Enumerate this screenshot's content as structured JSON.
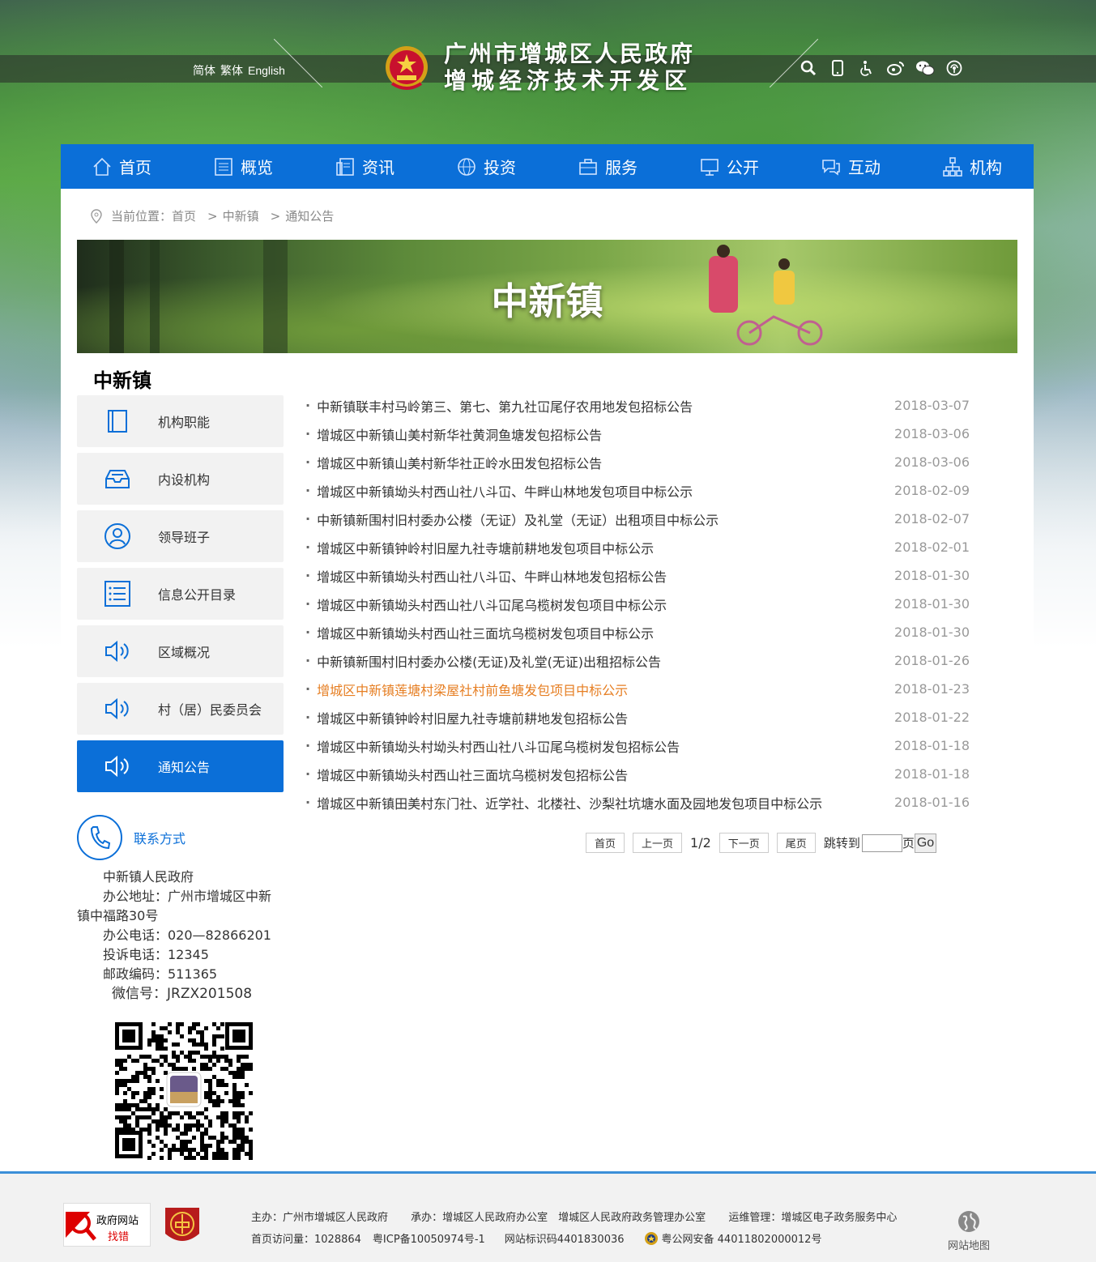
{
  "lang": [
    "简体",
    "繁体",
    "English"
  ],
  "site_title": {
    "line1": "广州市增城区人民政府",
    "line2": "增城经济技术开发区"
  },
  "tools": [
    "search-icon",
    "mobile-icon",
    "accessibility-icon",
    "weibo-icon",
    "wechat-icon",
    "broadcast-icon"
  ],
  "nav": [
    {
      "label": "首页",
      "icon": "home-icon"
    },
    {
      "label": "概览",
      "icon": "list-icon"
    },
    {
      "label": "资讯",
      "icon": "news-icon"
    },
    {
      "label": "投资",
      "icon": "globe-icon"
    },
    {
      "label": "服务",
      "icon": "briefcase-icon"
    },
    {
      "label": "公开",
      "icon": "monitor-icon"
    },
    {
      "label": "互动",
      "icon": "chat-icon"
    },
    {
      "label": "机构",
      "icon": "org-icon"
    }
  ],
  "breadcrumb": {
    "prefix": "当前位置：",
    "items": [
      "首页",
      "中新镇",
      "通知公告"
    ],
    "sep": ">"
  },
  "banner_title": "中新镇",
  "side_title": "中新镇",
  "side_menu": [
    {
      "label": "机构职能",
      "icon": "book-icon"
    },
    {
      "label": "内设机构",
      "icon": "tray-icon"
    },
    {
      "label": "领导班子",
      "icon": "user-icon"
    },
    {
      "label": "信息公开目录",
      "icon": "checklist-icon"
    },
    {
      "label": "区域概况",
      "icon": "speaker-icon"
    },
    {
      "label": "村（居）民委员会",
      "icon": "speaker-icon"
    },
    {
      "label": "通知公告",
      "icon": "speaker-icon",
      "active": true
    }
  ],
  "contact": {
    "title": "联系方式",
    "lines": [
      "中新镇人民政府",
      "办公地址：广州市增城区中新镇中福路30号",
      "办公电话：020—82866201",
      "投诉电话：12345",
      "邮政编码：511365"
    ],
    "wechat": "微信号：JRZX201508"
  },
  "news": [
    {
      "title": "中新镇联丰村马岭第三、第七、第九社冚尾仔农用地发包招标公告",
      "date": "2018-03-07"
    },
    {
      "title": "增城区中新镇山美村新华社黄洞鱼塘发包招标公告",
      "date": "2018-03-06"
    },
    {
      "title": "增城区中新镇山美村新华社正岭水田发包招标公告",
      "date": "2018-03-06"
    },
    {
      "title": "增城区中新镇坳头村西山社八斗冚、牛畔山林地发包项目中标公示",
      "date": "2018-02-09"
    },
    {
      "title": "中新镇新围村旧村委办公楼（无证）及礼堂（无证）出租项目中标公示",
      "date": "2018-02-07"
    },
    {
      "title": "增城区中新镇钟岭村旧屋九社寺塘前耕地发包项目中标公示",
      "date": "2018-02-01"
    },
    {
      "title": "增城区中新镇坳头村西山社八斗冚、牛畔山林地发包招标公告",
      "date": "2018-01-30"
    },
    {
      "title": "增城区中新镇坳头村西山社八斗冚尾乌榄树发包项目中标公示",
      "date": "2018-01-30"
    },
    {
      "title": "增城区中新镇坳头村西山社三面坑乌榄树发包项目中标公示",
      "date": "2018-01-30"
    },
    {
      "title": "中新镇新围村旧村委办公楼(无证)及礼堂(无证)出租招标公告",
      "date": "2018-01-26"
    },
    {
      "title": "增城区中新镇莲塘村梁屋社村前鱼塘发包项目中标公示",
      "date": "2018-01-23",
      "highlight": true
    },
    {
      "title": "增城区中新镇钟岭村旧屋九社寺塘前耕地发包招标公告",
      "date": "2018-01-22"
    },
    {
      "title": "增城区中新镇坳头村坳头村西山社八斗冚尾乌榄树发包招标公告",
      "date": "2018-01-18"
    },
    {
      "title": "增城区中新镇坳头村西山社三面坑乌榄树发包招标公告",
      "date": "2018-01-18"
    },
    {
      "title": "增城区中新镇田美村东门社、近学社、北楼社、沙梨社坑塘水面及园地发包项目中标公示",
      "date": "2018-01-16"
    }
  ],
  "pager": {
    "first": "首页",
    "prev": "上一页",
    "info": "1/2",
    "next": "下一页",
    "last": "尾页",
    "jump_label": "跳转到",
    "page_unit": "页",
    "go": "Go",
    "input_value": ""
  },
  "footer": {
    "err_line1": "政府网站",
    "err_line2": "找错",
    "host": "主办：广州市增城区人民政府",
    "undertake": "承办：增城区人民政府办公室　增城区人民政府政务管理办公室",
    "ops": "运维管理：增城区电子政务服务中心",
    "visits": "首页访问量：1028864",
    "icp": "粤ICP备10050974号-1",
    "site_code": "网站标识码4401830036",
    "police": "粤公网安备 44011802000012号",
    "sitemap": "网站地图"
  },
  "colors": {
    "nav_blue": "#0b6fd8",
    "highlight_orange": "#e67e22",
    "footer_border": "#3c8fd8"
  }
}
